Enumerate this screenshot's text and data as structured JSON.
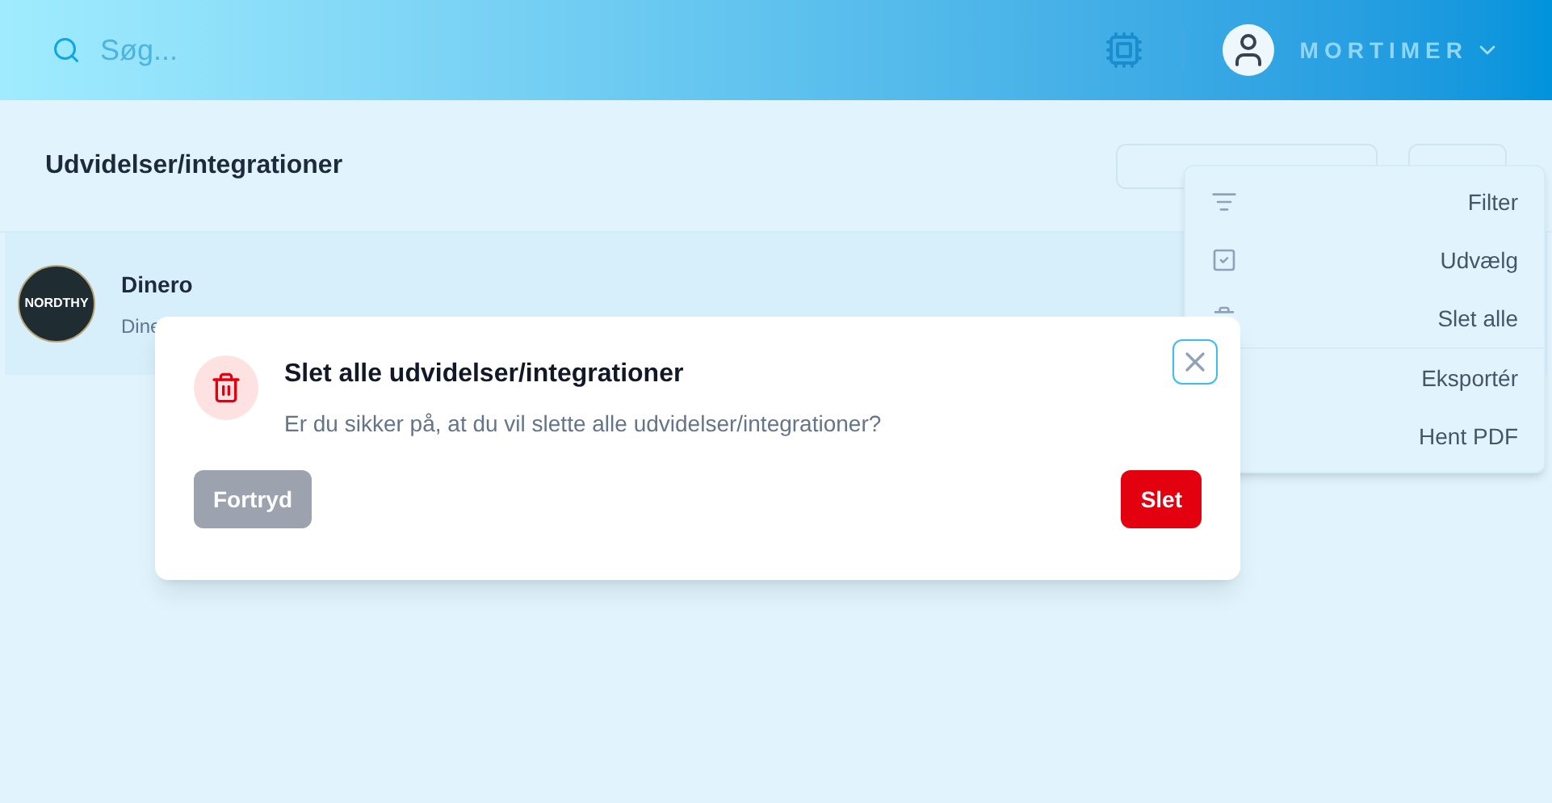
{
  "header": {
    "search": {
      "placeholder": "Søg..."
    },
    "user": {
      "name": "MORTIMER"
    }
  },
  "page": {
    "title": "Udvidelser/integrationer"
  },
  "list": [
    {
      "logo_text": "NORDTHY",
      "name": "Dinero",
      "subtitle": "Dine"
    }
  ],
  "menu": {
    "groups": [
      [
        {
          "label": "Filter",
          "kind": "filter"
        },
        {
          "label": "Udvælg",
          "kind": "select"
        },
        {
          "label": "Slet alle",
          "kind": "delete"
        }
      ],
      [
        {
          "label": "Eksportér",
          "kind": "plain"
        },
        {
          "label": "Hent PDF",
          "kind": "plain"
        }
      ]
    ]
  },
  "dialog": {
    "title": "Slet alle udvidelser/integrationer",
    "message": "Er du sikker på, at du vil slette alle udvidelser/integrationer?",
    "buttons": [
      {
        "label": "Fortryd",
        "kind": "cancel",
        "disabled": true
      },
      {
        "label": "Slet",
        "kind": "danger",
        "disabled": false
      }
    ]
  }
}
